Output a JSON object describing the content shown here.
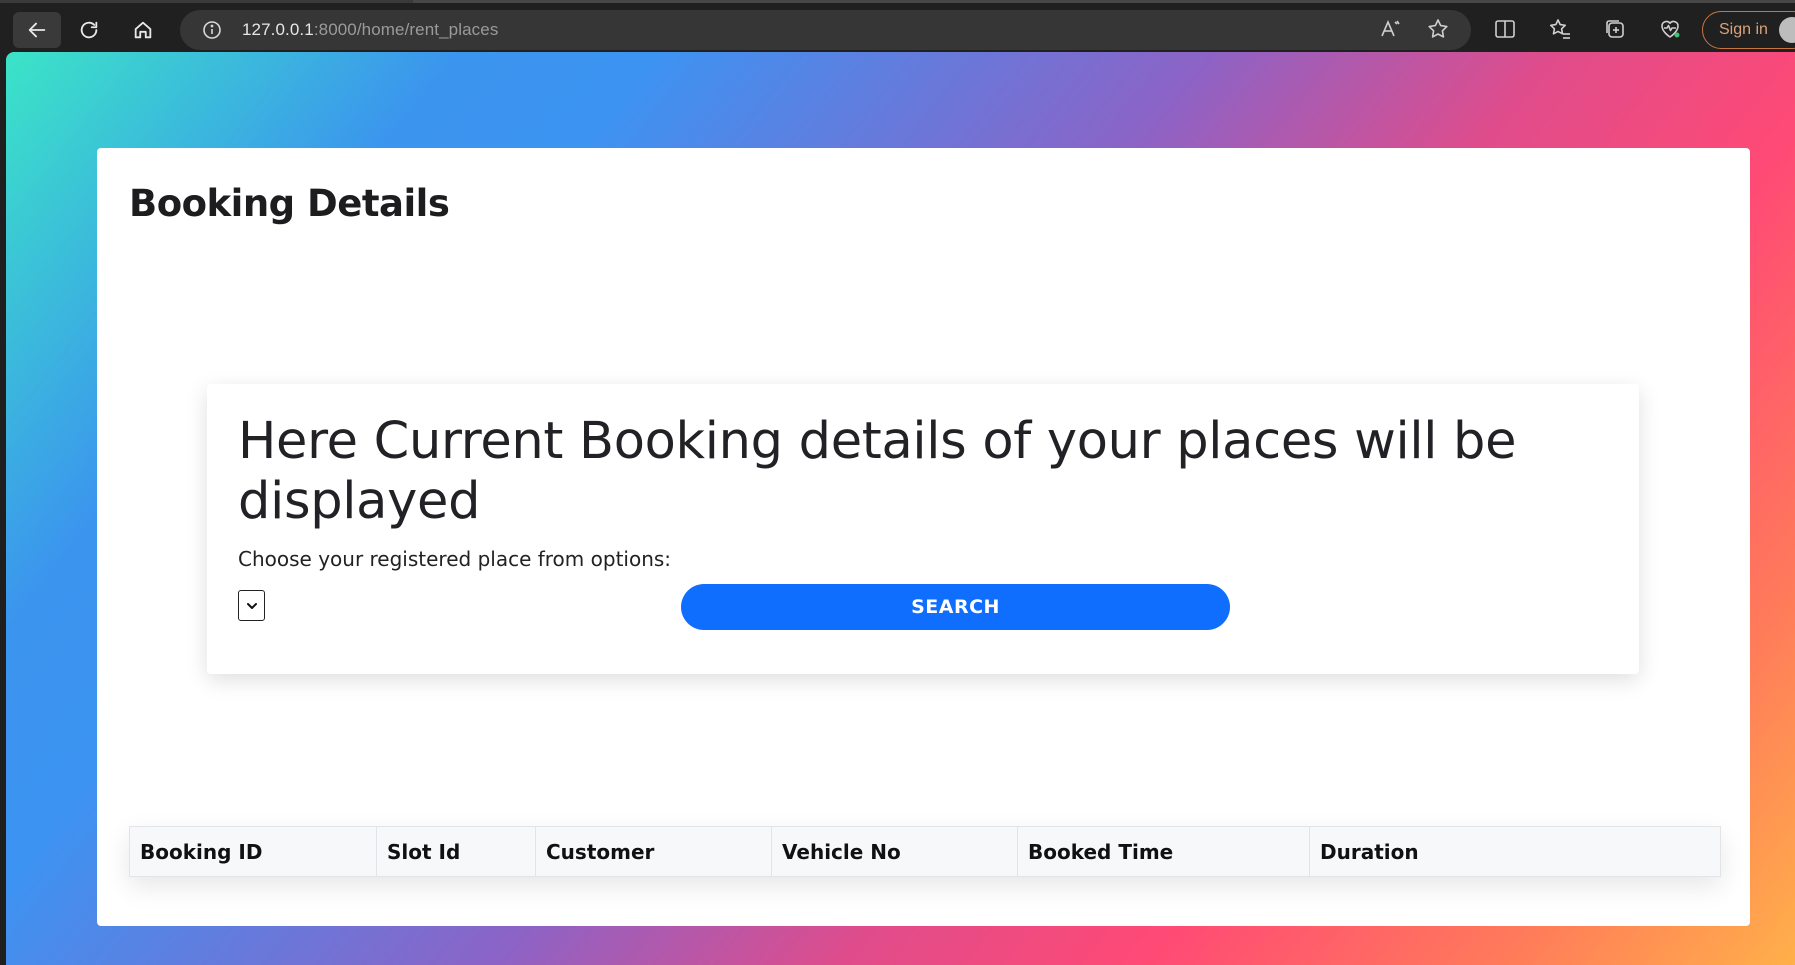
{
  "browser": {
    "url_host": "127.0.0.1",
    "url_rest": ":8000/home/rent_places",
    "sign_in_label": "Sign in"
  },
  "page": {
    "title": "Booking Details",
    "panel_heading": "Here Current Booking details of your places will be displayed",
    "choose_label": "Choose your registered place from options:",
    "select_value": "",
    "search_label": "SEARCH"
  },
  "table": {
    "headers": [
      "Booking ID",
      "Slot Id",
      "Customer",
      "Vehicle No",
      "Booked Time",
      "Duration"
    ],
    "rows": []
  },
  "colors": {
    "primary_button": "#0f6efd",
    "chrome_bg": "#202020",
    "sign_in_border": "#c9753f"
  }
}
